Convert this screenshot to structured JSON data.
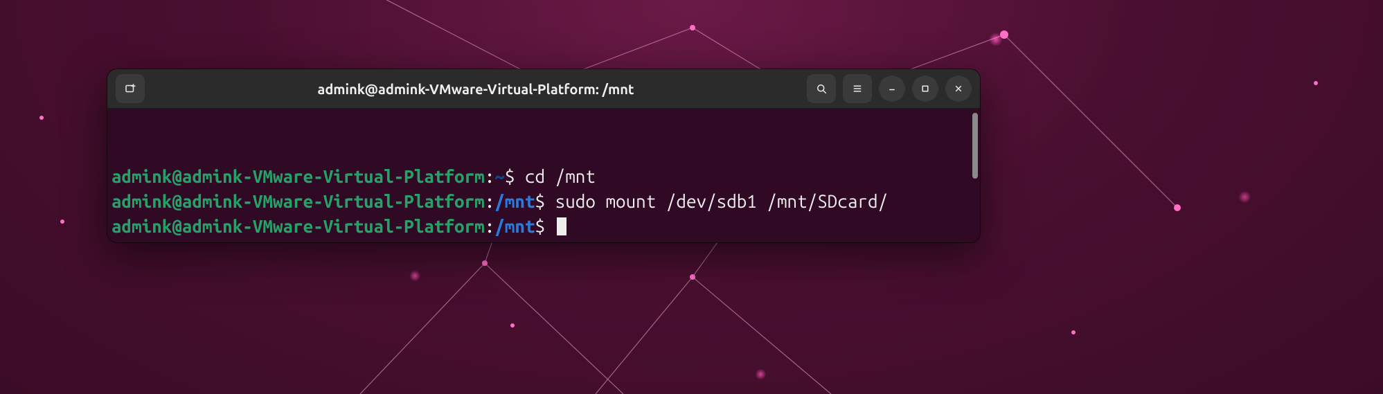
{
  "window": {
    "title": "admink@admink-VMware-Virtual-Platform: /mnt"
  },
  "terminal": {
    "lines": [
      {
        "user_host": "admink@admink-VMware-Virtual-Platform",
        "colon": ":",
        "path": "~",
        "path_class": "c-path-home",
        "dollar": "$ ",
        "command": "cd /mnt"
      },
      {
        "user_host": "admink@admink-VMware-Virtual-Platform",
        "colon": ":",
        "path": "/mnt",
        "path_class": "c-path",
        "dollar": "$ ",
        "command": "sudo mount /dev/sdb1 /mnt/SDcard/"
      },
      {
        "user_host": "admink@admink-VMware-Virtual-Platform",
        "colon": ":",
        "path": "/mnt",
        "path_class": "c-path",
        "dollar": "$ ",
        "command": "",
        "cursor": true
      }
    ]
  },
  "icons": {
    "new_tab": "new-tab",
    "search": "search",
    "menu": "menu",
    "minimize": "minimize",
    "maximize": "maximize",
    "close": "close"
  }
}
